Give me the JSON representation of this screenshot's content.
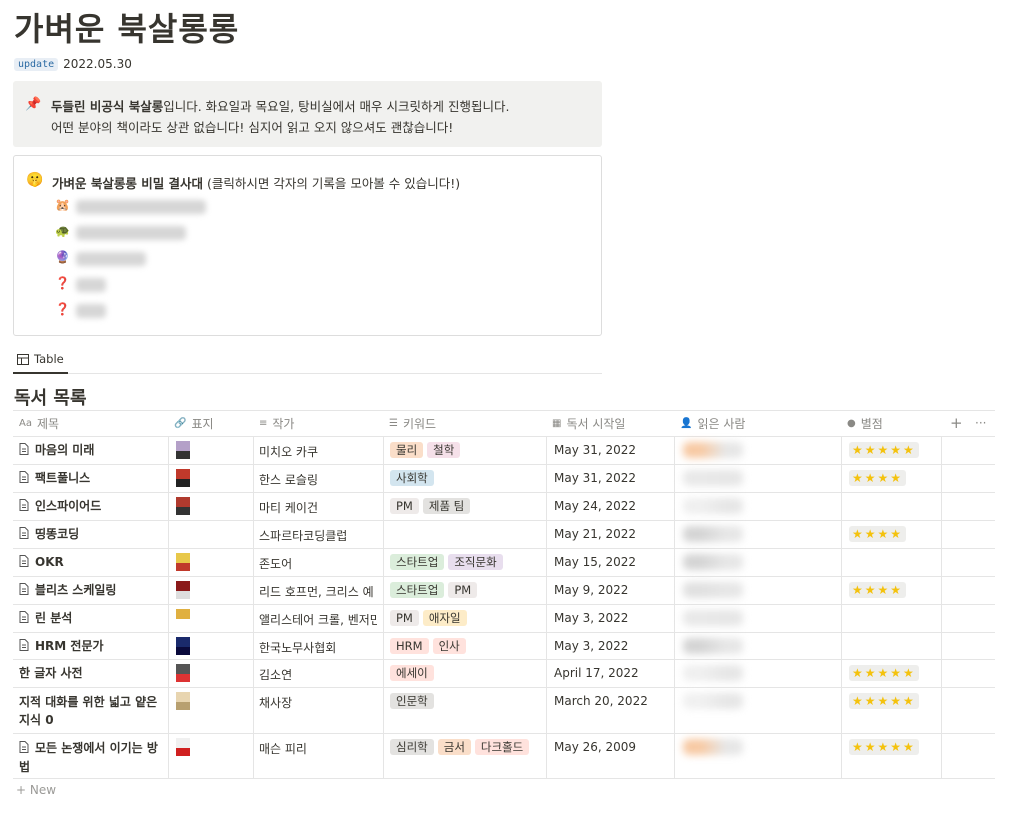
{
  "page": {
    "title": "가벼운 북살롱롱",
    "update_badge": "update",
    "update_date": "2022.05.30"
  },
  "callout_intro": {
    "icon": "pushpin-icon",
    "bold": "두들린 비공식 북살롱",
    "line1_rest": "입니다. 화요일과 목요일, 탕비실에서 매우 시크릿하게 진행됩니다.",
    "line2": "어떤 분야의 책이라도 상관 없습니다! 심지어 읽고 오지 않으셔도 괜찮습니다!"
  },
  "callout_members": {
    "icon": "shushing-face-icon",
    "bold": "가벼운 북살롱롱 비밀 결사대",
    "rest": " (클릭하시면 각자의 기록을 모아볼 수 있습니다!)",
    "members": [
      {
        "icon": "🐹"
      },
      {
        "icon": "🐢"
      },
      {
        "icon": "🔮"
      },
      {
        "icon": "❓"
      },
      {
        "icon": "❓"
      }
    ]
  },
  "view_tab": {
    "label": "Table"
  },
  "database": {
    "title": "독서 목록",
    "columns": [
      {
        "label": "제목",
        "icon": "Aa"
      },
      {
        "label": "표지",
        "icon": "paperclip-icon"
      },
      {
        "label": "작가",
        "icon": "text-lines-icon"
      },
      {
        "label": "키워드",
        "icon": "list-icon"
      },
      {
        "label": "독서 시작일",
        "icon": "calendar-icon"
      },
      {
        "label": "읽은 사람",
        "icon": "person-icon"
      },
      {
        "label": "별점",
        "icon": "select-icon"
      }
    ],
    "rows": [
      {
        "title": "마음의 미래",
        "author": "미치오 카쿠",
        "keywords": [
          "물리",
          "철학"
        ],
        "date": "May 31, 2022",
        "rating": 5
      },
      {
        "title": "팩트풀니스",
        "author": "한스 로슬링",
        "keywords": [
          "사회학"
        ],
        "date": "May 31, 2022",
        "rating": 4
      },
      {
        "title": "인스파이어드",
        "author": "마티 케이건",
        "keywords": [
          "PM",
          "제품 팀"
        ],
        "date": "May 24, 2022",
        "rating": 0
      },
      {
        "title": "띵똥코딩",
        "author": "스파르타코딩클럽",
        "keywords": [],
        "date": "May 21, 2022",
        "rating": 4
      },
      {
        "title": "OKR",
        "author": "존도어",
        "keywords": [
          "스타트업",
          "조직문화"
        ],
        "date": "May 15, 2022",
        "rating": 0
      },
      {
        "title": "블리츠 스케일링",
        "author": "리드 호프먼, 크리스 예",
        "keywords": [
          "스타트업",
          "PM"
        ],
        "date": "May 9, 2022",
        "rating": 4
      },
      {
        "title": "린 분석",
        "author": "앨리스테어 크롤, 벤저민 요",
        "keywords": [
          "PM",
          "애자일"
        ],
        "date": "May 3, 2022",
        "rating": 0
      },
      {
        "title": "HRM 전문가",
        "author": "한국노무사협회",
        "keywords": [
          "HRM",
          "인사"
        ],
        "date": "May 3, 2022",
        "rating": 0
      },
      {
        "title": "한 글자 사전",
        "author": "김소연",
        "keywords": [
          "에세이"
        ],
        "date": "April 17, 2022",
        "rating": 5
      },
      {
        "title": "지적 대화를 위한 넓고 얕은 지식 0",
        "author": "채사장",
        "keywords": [
          "인문학"
        ],
        "date": "March 20, 2022",
        "rating": 5
      },
      {
        "title": "모든 논쟁에서 이기는 방법",
        "author": "매슨 피리",
        "keywords": [
          "심리학",
          "금서",
          "다크홀드"
        ],
        "date": "May 26, 2009",
        "rating": 5
      }
    ],
    "new_label": "New"
  },
  "tag_colors": {
    "물리": "#fadec9",
    "철학": "#f5e0e9",
    "사회학": "#d3e5ef",
    "PM": "#eeeae9",
    "제품 팀": "#e3e2e0",
    "스타트업": "#dbeddb",
    "조직문화": "#e8deee",
    "애자일": "#fdecc8",
    "HRM": "#ffe2dd",
    "인사": "#ffe2dd",
    "에세이": "#ffe2dd",
    "인문학": "#e3e2e0",
    "심리학": "#e3e2e0",
    "금서": "#fadec9",
    "다크홀드": "#ffe2dd"
  }
}
